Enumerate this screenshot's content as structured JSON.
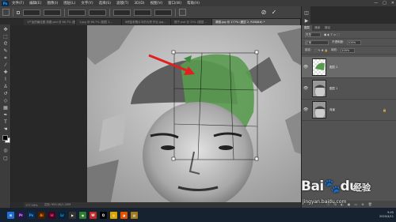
{
  "app": {
    "logo": "Ps"
  },
  "menu": [
    "文件(F)",
    "编辑(E)",
    "图像(I)",
    "图层(L)",
    "文字(Y)",
    "选择(S)",
    "滤镜(T)",
    "3D(D)",
    "视图(V)",
    "窗口(W)",
    "帮助(H)"
  ],
  "window_controls": {
    "minimize": "—",
    "maximize": "□",
    "close": "✕"
  },
  "options": {
    "cancel_label": "⊘",
    "commit_label": "✓"
  },
  "tabs": [
    {
      "label": "1产品的最佳图 原图.psd @ 66.7% (图层..."
    },
    {
      "label": "1.jpg @ 66.7% (图层 3..."
    },
    {
      "label": "6修复老照片中的污渍 作业.jpg..."
    },
    {
      "label": "帽子.psd @ 25% (图层..."
    },
    {
      "label": "原图.jpg @ 177% (图层 2, RGB/8#) *",
      "active": true
    }
  ],
  "status": {
    "zoom": "177.16%",
    "doc": "文档: 955.0K/1.20M"
  },
  "layers_panel": {
    "tabs": [
      "图层",
      "通道",
      "路径"
    ],
    "kind_label": "类型",
    "blend_mode": "正常",
    "opacity_label": "不透明度:",
    "opacity_value": "100%",
    "lock_label": "锁定:",
    "fill_label": "填充:",
    "fill_value": "100%",
    "layers": [
      {
        "name": "图层 2"
      },
      {
        "name": "图层 1"
      },
      {
        "name": "背景"
      }
    ],
    "footer_icons": [
      "ⓕ",
      "fx",
      "◐",
      "▣",
      "▭",
      "⊕",
      "🗑"
    ]
  },
  "taskbar": {
    "apps": [
      {
        "name": "windows",
        "label": "⊞",
        "color": "#1f6fd6"
      },
      {
        "name": "premiere",
        "label": "Pr",
        "color": "#2a1450"
      },
      {
        "name": "photoshop",
        "label": "Ps",
        "color": "#0b2c4e"
      },
      {
        "name": "illustrator",
        "label": "Ai",
        "color": "#4a2000"
      },
      {
        "name": "indesign",
        "label": "Id",
        "color": "#49021f"
      },
      {
        "name": "lightroom",
        "label": "Lr",
        "color": "#06233b"
      },
      {
        "name": "media-player",
        "label": "▶",
        "color": "#333333"
      },
      {
        "name": "browser",
        "label": "◉",
        "color": "#2e7d32"
      },
      {
        "name": "wps",
        "label": "W",
        "color": "#c62828"
      },
      {
        "name": "qq",
        "label": "Q",
        "color": "#000000"
      },
      {
        "name": "chrome",
        "label": "◎",
        "color": "#d9a400"
      },
      {
        "name": "firefox",
        "label": "◕",
        "color": "#e65100"
      },
      {
        "name": "folder",
        "label": "▤",
        "color": "#a07a20"
      }
    ],
    "time": "9:45",
    "date": "2020/4/11"
  },
  "watermark": {
    "logo": "Bai",
    "paw": "du",
    "text": "经验",
    "url": "jingyan.baidu.com"
  }
}
